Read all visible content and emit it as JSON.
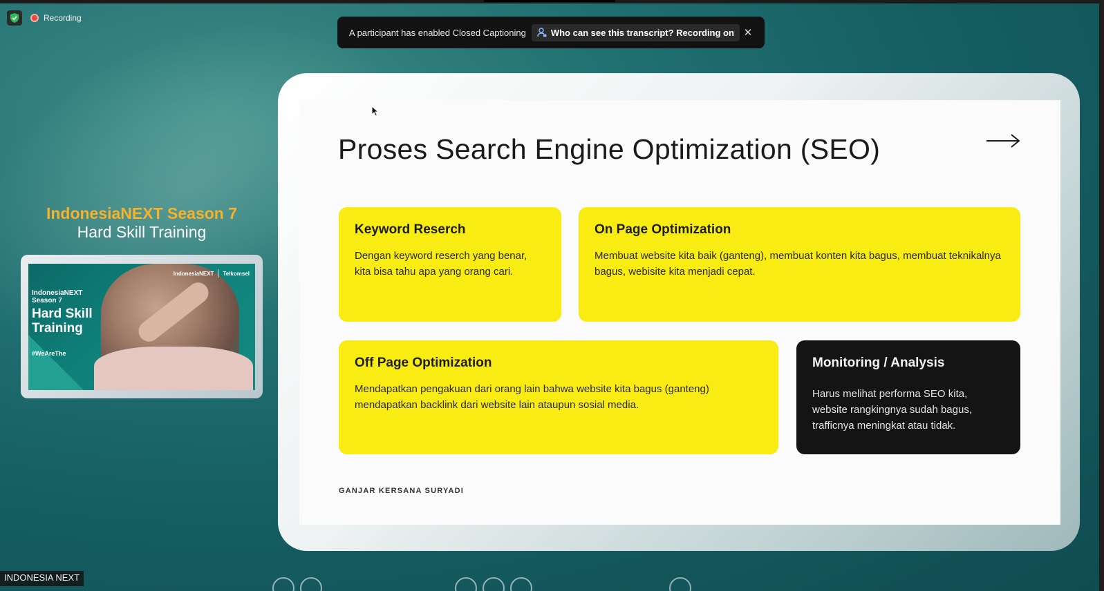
{
  "window": {
    "recording_label": "Recording",
    "participant_name": "INDONESIA NEXT"
  },
  "banner": {
    "message": "A participant has enabled Closed Captioning",
    "link_label": "Who can see this transcript? Recording on",
    "close_glyph": "✕"
  },
  "brand": {
    "title": "IndonesiaNEXT Season 7",
    "subtitle": "Hard Skill Training"
  },
  "video": {
    "logo_left": "IndonesiaNEXT",
    "logo_right": "Telkomsel",
    "line1": "IndonesiaNEXT",
    "line2": "Season 7",
    "heading_1": "Hard Skill",
    "heading_2": "Training",
    "hashtag": "#WeAreThe"
  },
  "slide": {
    "title": "Proses Search Engine Optimization (SEO)",
    "cards": [
      {
        "title": "Keyword Reserch",
        "body": "Dengan keyword reserch yang benar, kita bisa tahu apa yang orang cari."
      },
      {
        "title": "On Page Optimization",
        "body": "Membuat website kita baik (ganteng), membuat konten kita bagus, membuat teknikalnya bagus, webisite kita menjadi cepat."
      },
      {
        "title": "Off Page Optimization",
        "body": "Mendapatkan pengakuan dari orang lain bahwa website kita bagus (ganteng) mendapatkan backlink dari website lain ataupun sosial media."
      },
      {
        "title": "Monitoring / Analysis",
        "body": "Harus melihat performa SEO kita, website rangkingnya sudah bagus, trafficnya meningkat atau tidak."
      }
    ],
    "author": "GANJAR KERSANA SURYADI"
  },
  "colors": {
    "card_yellow": "#f8ec12",
    "card_dark": "#141414",
    "brand_orange": "#f7b22a",
    "recording_red": "#e64b3c"
  }
}
